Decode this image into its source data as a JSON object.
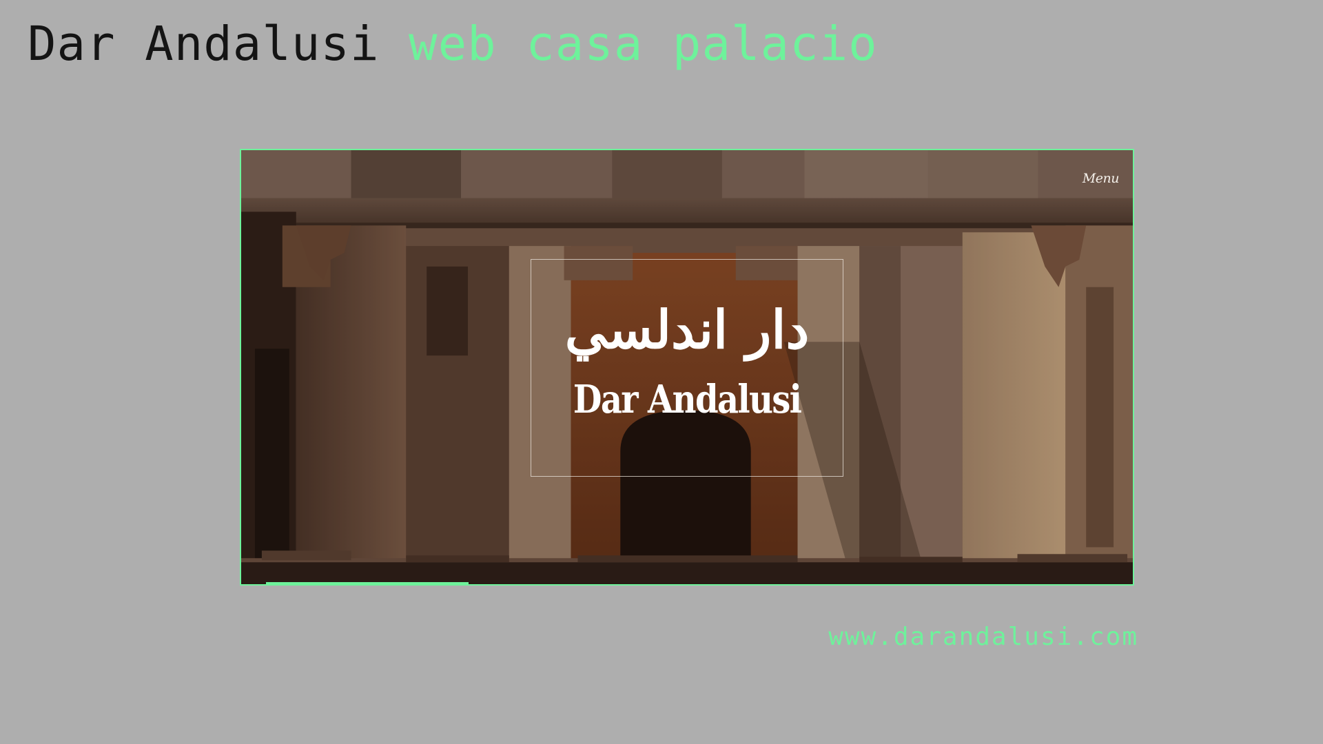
{
  "header": {
    "title_main": "Dar Andalusi",
    "title_accent": "web casa palacio"
  },
  "site_preview": {
    "menu_label": "Menu",
    "logo_arabic": "دار اندلسي",
    "logo_latin": "Dar Andalusi",
    "hero_image": "riad-courtyard-photo"
  },
  "footer": {
    "url": "www.darandalusi.com"
  },
  "colors": {
    "background": "#aeaeae",
    "accent": "#6ef29b",
    "title_text": "#141414"
  }
}
